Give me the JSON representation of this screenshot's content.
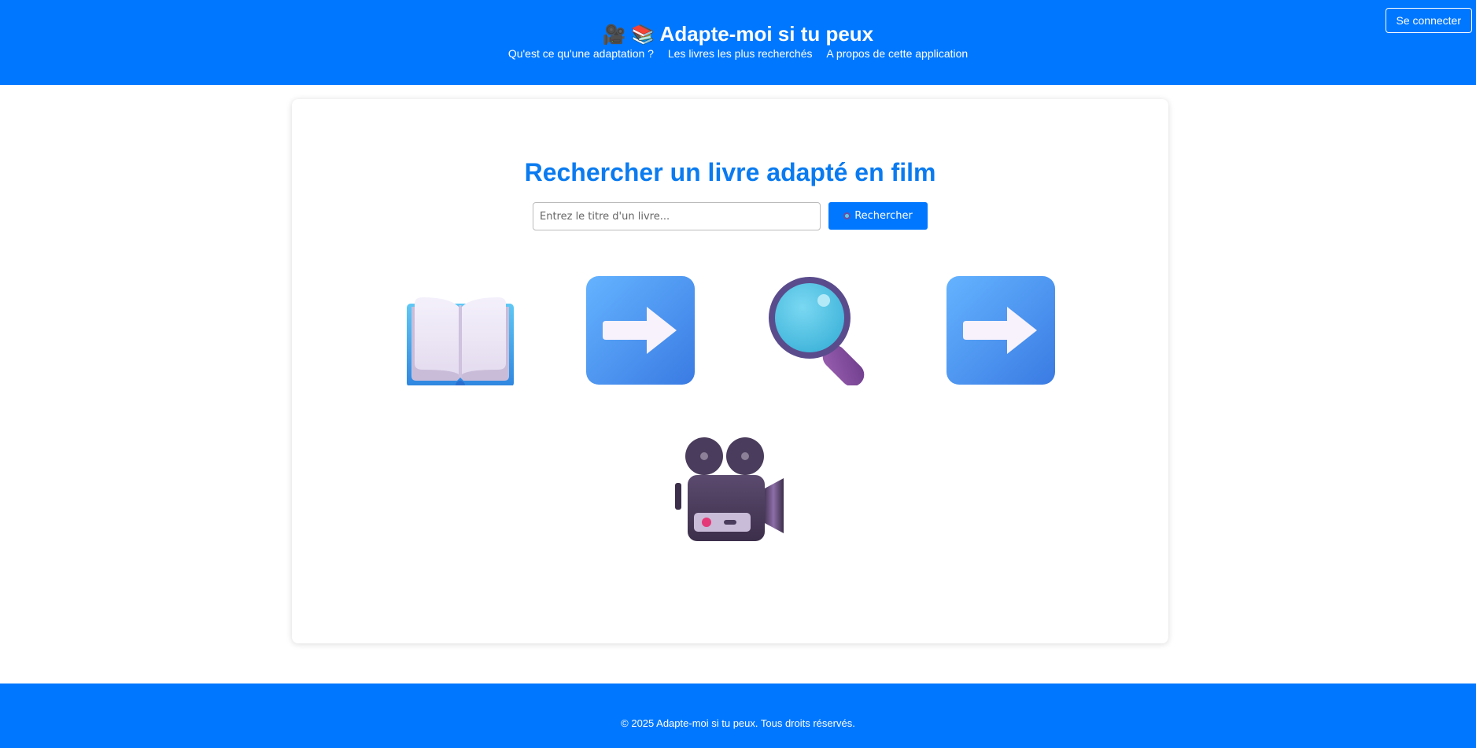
{
  "header": {
    "title_emoji": "🎥 📚",
    "title": "Adapte-moi si tu peux",
    "nav": [
      "Qu'est ce qu'une adaptation ?",
      "Les livres les plus recherchés",
      "A propos de cette application"
    ],
    "login_label": "Se connecter"
  },
  "search": {
    "title": "Rechercher un livre adapté en film",
    "placeholder": "Entrez le titre d'un livre...",
    "button_label": "Rechercher",
    "button_icon": "magnifier-icon"
  },
  "illustration": {
    "icons": [
      "open-book-icon",
      "right-arrow-icon",
      "magnifying-glass-icon",
      "right-arrow-icon",
      "movie-camera-icon"
    ]
  },
  "footer": {
    "text": "© 2025 Adapte-moi si tu peux. Tous droits réservés."
  },
  "colors": {
    "primary": "#0077ff",
    "title": "#0a7bf0",
    "background": "#ffffff"
  }
}
